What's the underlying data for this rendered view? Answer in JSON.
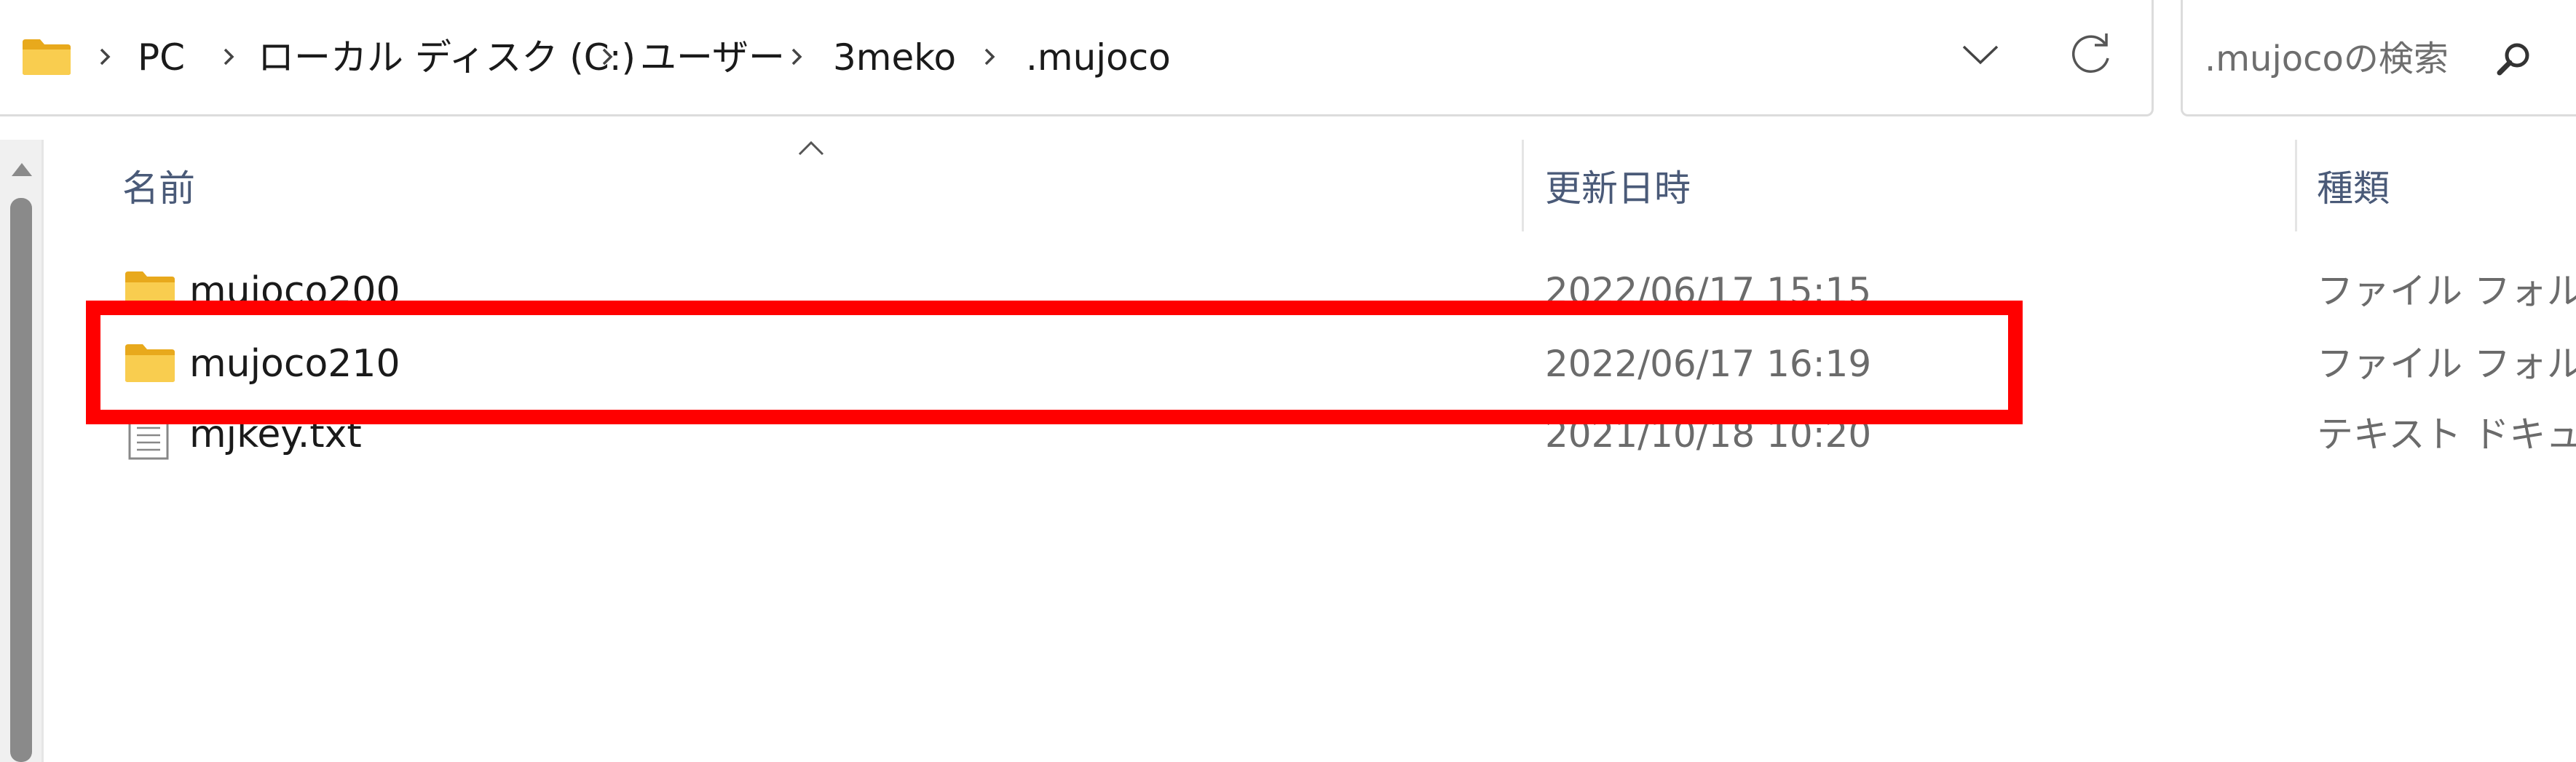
{
  "address_bar": {
    "breadcrumbs": [
      {
        "label": "PC"
      },
      {
        "label": "ローカル ディスク (C:)"
      },
      {
        "label": "ユーザー"
      },
      {
        "label": "3meko"
      },
      {
        "label": ".mujoco"
      }
    ],
    "folder_icon": "folder-icon",
    "dropdown_icon": "chevron-down-icon",
    "refresh_icon": "refresh-icon"
  },
  "search": {
    "placeholder": ".mujocoの検索",
    "icon": "search-icon"
  },
  "columns": {
    "name": "名前",
    "modified": "更新日時",
    "type": "種類"
  },
  "files": [
    {
      "name": "mujoco200",
      "modified": "2022/06/17 15:15",
      "type": "ファイル フォルダー",
      "icon": "folder-icon"
    },
    {
      "name": "mujoco210",
      "modified": "2022/06/17 16:19",
      "type": "ファイル フォルダー",
      "icon": "folder-icon"
    },
    {
      "name": "mjkey.txt",
      "modified": "2021/10/18 10:20",
      "type": "テキスト ドキュメント",
      "icon": "text-file-icon"
    }
  ],
  "colors": {
    "highlight": "#ff0000",
    "folder": "#f7c948",
    "header_text": "#4a5a78"
  }
}
